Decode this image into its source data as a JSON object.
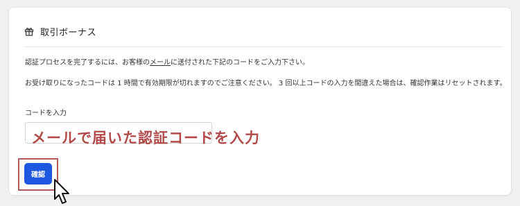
{
  "header": {
    "icon": "gift-icon",
    "title": "取引ボーナス"
  },
  "instruction": {
    "before_link": "認証プロセスを完了するには、お客様の",
    "link": "メール",
    "after_link": "に送付された下記のコードをご入力下さい。"
  },
  "note": "お受け取りになったコードは 1 時間で有効期限が切れますのでご注意ください。 3 回以上コードの入力を間違えた場合は、確認作業はリセットされます。",
  "code_field": {
    "label": "コードを入力",
    "value": "",
    "placeholder": ""
  },
  "annotation": "メールで届いた認証コードを入力",
  "confirm_button": {
    "label": "確認"
  },
  "colors": {
    "accent": "#1e57e0",
    "annotation": "#b34a4a",
    "highlight_border": "#b15b5b"
  }
}
